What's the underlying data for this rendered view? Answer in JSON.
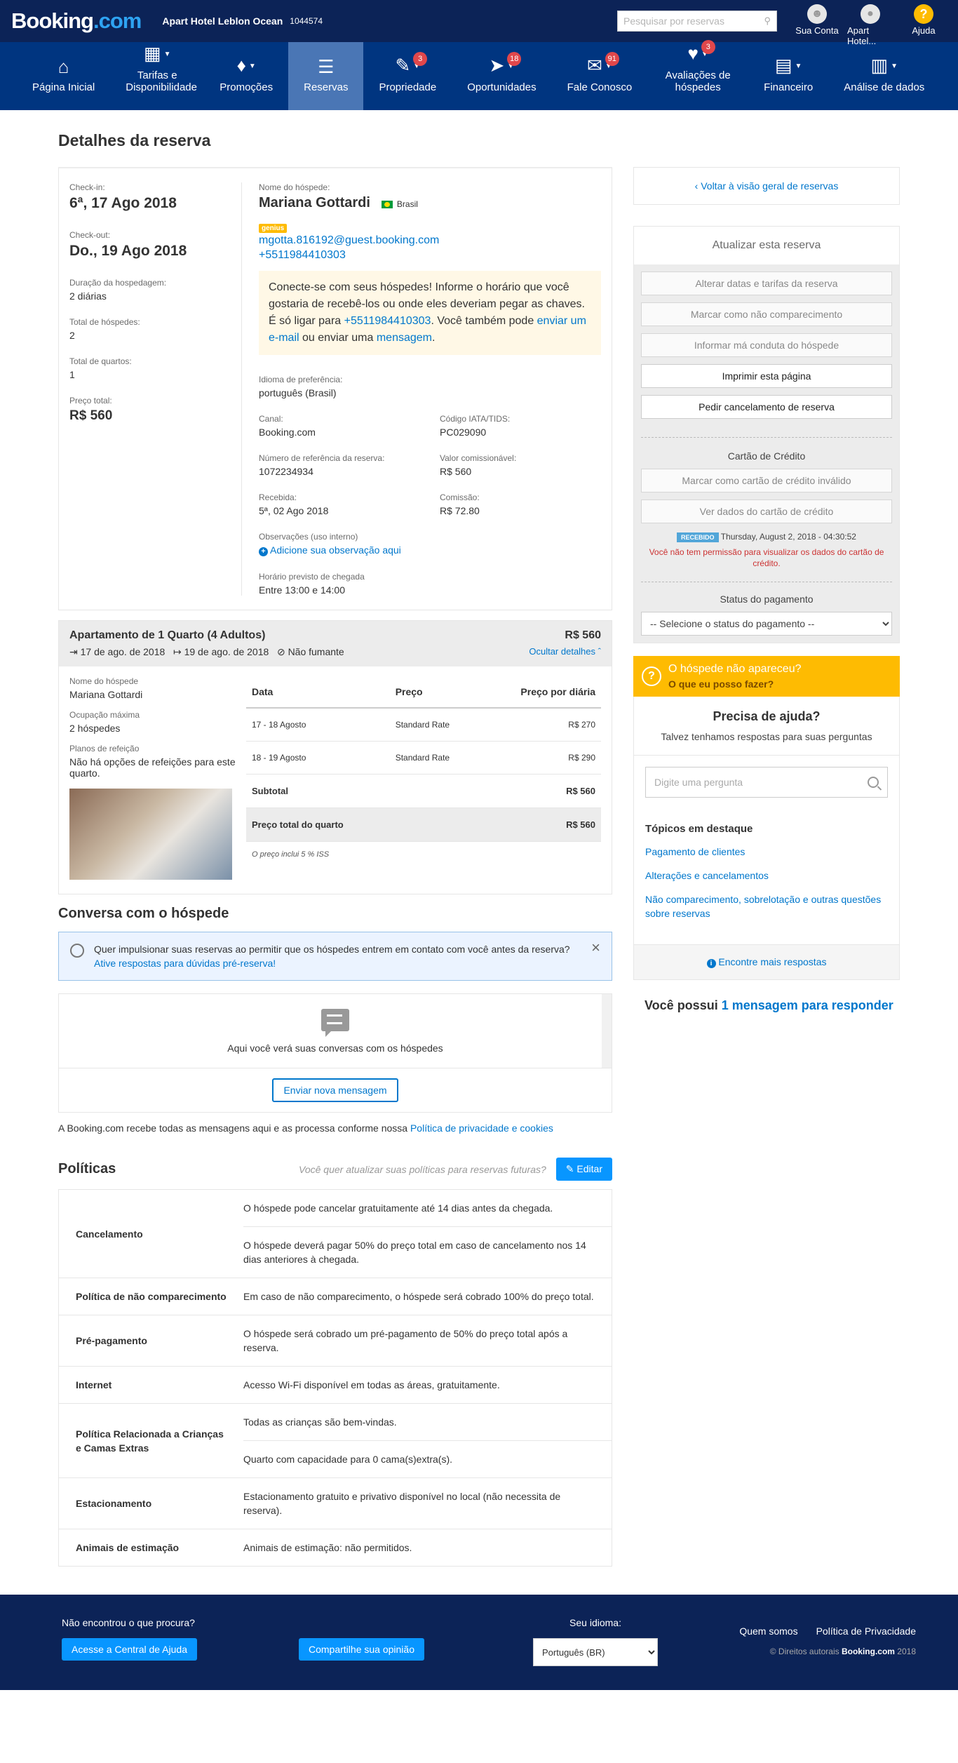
{
  "topbar": {
    "logo_main": "Booking",
    "logo_dot": ".com",
    "hotel_name": "Apart Hotel Leblon Ocean",
    "hotel_id": "1044574",
    "search_placeholder": "Pesquisar por reservas",
    "account": "Sua Conta",
    "property": "Apart Hotel...",
    "help": "Ajuda"
  },
  "nav": [
    {
      "label": "Página Inicial",
      "icon": "home-icon",
      "badge": ""
    },
    {
      "label": "Tarifas e Disponibilidade",
      "icon": "calendar-icon",
      "badge": ""
    },
    {
      "label": "Promoções",
      "icon": "tag-icon",
      "badge": ""
    },
    {
      "label": "Reservas",
      "icon": "list-icon",
      "badge": ""
    },
    {
      "label": "Propriedade",
      "icon": "pencil-icon",
      "badge": "3"
    },
    {
      "label": "Oportunidades",
      "icon": "rocket-icon",
      "badge": "18"
    },
    {
      "label": "Fale Conosco",
      "icon": "envelope-icon",
      "badge": "91"
    },
    {
      "label": "Avaliações de hóspedes",
      "icon": "heart-icon",
      "badge": "3"
    },
    {
      "label": "Financeiro",
      "icon": "document-icon",
      "badge": ""
    },
    {
      "label": "Análise de dados",
      "icon": "bar-chart-icon",
      "badge": ""
    }
  ],
  "page_title": "Detalhes da reserva",
  "reservation": {
    "checkin_label": "Check-in:",
    "checkin": "6ª, 17 Ago 2018",
    "checkout_label": "Check-out:",
    "checkout": "Do., 19 Ago 2018",
    "duration_label": "Duração da hospedagem:",
    "duration": "2 diárias",
    "guests_label": "Total de hóspedes:",
    "guests": "2",
    "rooms_label": "Total de quartos:",
    "rooms": "1",
    "price_label": "Preço total:",
    "price": "R$ 560",
    "guest_name_label": "Nome do hóspede:",
    "guest_name": "Mariana Gottardi",
    "country": "Brasil",
    "genius": "genius",
    "email": "mgotta.816192@guest.booking.com",
    "phone": "+5511984410303",
    "notice_1": "Conecte-se com seus hóspedes! Informe o horário que você gostaria de recebê-los ou onde eles deveriam pegar as chaves. É só ligar para ",
    "notice_phone": "+5511984410303",
    "notice_2": ". Você também pode ",
    "notice_email_link": "enviar um e-mail",
    "notice_3": " ou enviar uma ",
    "notice_msg_link": "mensagem",
    "notice_4": ".",
    "language_label": "Idioma de preferência:",
    "language": "português (Brasil)",
    "channel_label": "Canal:",
    "channel": "Booking.com",
    "iata_label": "Código IATA/TIDS:",
    "iata": "PC029090",
    "ref_label": "Número de referência da reserva:",
    "ref": "1072234934",
    "commissionable_label": "Valor comissionável:",
    "commissionable": "R$ 560",
    "received_label": "Recebida:",
    "received": "5ª, 02 Ago 2018",
    "commission_label": "Comissão:",
    "commission": "R$ 72.80",
    "notes_label": "Observações (uso interno)",
    "notes_link": "Adicione sua observação aqui",
    "arrival_label": "Horário previsto de chegada",
    "arrival": "Entre 13:00 e 14:00"
  },
  "room": {
    "title": "Apartamento de 1 Quarto (4 Adultos)",
    "price": "R$ 560",
    "checkin": "17 de ago. de 2018",
    "checkout": "19 de ago. de 2018",
    "smoking": "Não fumante",
    "hide_details": "Ocultar detalhes",
    "guest_label": "Nome do hóspede",
    "guest": "Mariana Gottardi",
    "occupancy_label": "Ocupação máxima",
    "occupancy": "2 hóspedes",
    "meal_label": "Planos de refeição",
    "meal": "Não há opções de refeições para este quarto.",
    "table_headers": [
      "Data",
      "Preço",
      "Preço por diária"
    ],
    "rows": [
      {
        "date": "17 - 18 Agosto",
        "rate": "Standard Rate",
        "price": "R$ 270"
      },
      {
        "date": "18 - 19 Agosto",
        "rate": "Standard Rate",
        "price": "R$ 290"
      }
    ],
    "subtotal_label": "Subtotal",
    "subtotal": "R$ 560",
    "total_label": "Preço total do quarto",
    "total": "R$ 560",
    "tax_note": "O preço inclui 5 % ISS"
  },
  "conversation": {
    "title": "Conversa com o hóspede",
    "banner_text": "Quer impulsionar suas reservas ao permitir que os hóspedes entrem em contato com você antes da reserva?",
    "banner_link": "Ative respostas para dúvidas pré-reserva!",
    "empty_text": "Aqui você verá suas conversas com os hóspedes",
    "send_button": "Enviar nova mensagem",
    "privacy_text": "A Booking.com recebe todas as mensagens aqui e as processa conforme nossa ",
    "privacy_link": "Política de privacidade e cookies"
  },
  "policies": {
    "title": "Políticas",
    "question": "Você quer atualizar suas políticas para reservas futuras?",
    "edit": "Editar",
    "rows": [
      {
        "name": "Cancelamento",
        "texts": [
          "O hóspede pode cancelar gratuitamente até 14 dias antes da chegada.",
          "O hóspede deverá pagar 50% do preço total em caso de cancelamento nos 14 dias anteriores à chegada."
        ]
      },
      {
        "name": "Política de não comparecimento",
        "texts": [
          "Em caso de não comparecimento, o hóspede será cobrado 100% do preço total."
        ]
      },
      {
        "name": "Pré-pagamento",
        "texts": [
          "O hóspede será cobrado um pré-pagamento de 50% do preço total após a reserva."
        ]
      },
      {
        "name": "Internet",
        "texts": [
          "Acesso Wi-Fi disponível em todas as áreas, gratuitamente."
        ]
      },
      {
        "name": "Política Relacionada a Crianças e Camas Extras",
        "texts": [
          "Todas as crianças são bem-vindas.",
          "Quarto com capacidade para 0 cama(s)extra(s)."
        ]
      },
      {
        "name": "Estacionamento",
        "texts": [
          "Estacionamento gratuito e privativo disponível no local (não necessita de reserva)."
        ]
      },
      {
        "name": "Animais de estimação",
        "texts": [
          "Animais de estimação: não permitidos."
        ]
      }
    ]
  },
  "sidebar": {
    "back": "Voltar à visão geral de reservas",
    "update_title": "Atualizar esta reserva",
    "buttons": [
      "Alterar datas e tarifas da reserva",
      "Marcar como não comparecimento",
      "Informar má conduta do hóspede",
      "Imprimir esta página",
      "Pedir cancelamento de reserva"
    ],
    "cc_title": "Cartão de Crédito",
    "cc_buttons": [
      "Marcar como cartão de crédito inválido",
      "Ver dados do cartão de crédito"
    ],
    "received_badge": "RECEBIDO",
    "received_date": "Thursday, August 2, 2018 - 04:30:52",
    "cc_warning": "Você não tem permissão para visualizar os dados do cartão de crédito.",
    "payment_title": "Status do pagamento",
    "payment_select": "-- Selecione o status do pagamento --",
    "noshow_title": "O hóspede não apareceu?",
    "noshow_link": "O que eu posso fazer?",
    "help_title": "Precisa de ajuda?",
    "help_sub": "Talvez tenhamos respostas para suas perguntas",
    "help_placeholder": "Digite uma pergunta",
    "topics_title": "Tópicos em destaque",
    "topics": [
      "Pagamento de clientes",
      "Alterações e cancelamentos",
      "Não comparecimento, sobrelotação e outras questões sobre reservas"
    ],
    "more_answers": "Encontre mais respostas",
    "msg_prefix": "Você possui ",
    "msg_link": "1 mensagem para responder"
  },
  "footer": {
    "not_found": "Não encontrou o que procura?",
    "help_center": "Acesse a Central de Ajuda",
    "share": "Compartilhe sua opinião",
    "lang_label": "Seu idioma:",
    "lang_value": "Português (BR)",
    "about": "Quem somos",
    "privacy": "Política de Privacidade",
    "copy_prefix": "© Direitos autorais ",
    "copy_brand": "Booking.com",
    "copy_year": " 2018"
  }
}
